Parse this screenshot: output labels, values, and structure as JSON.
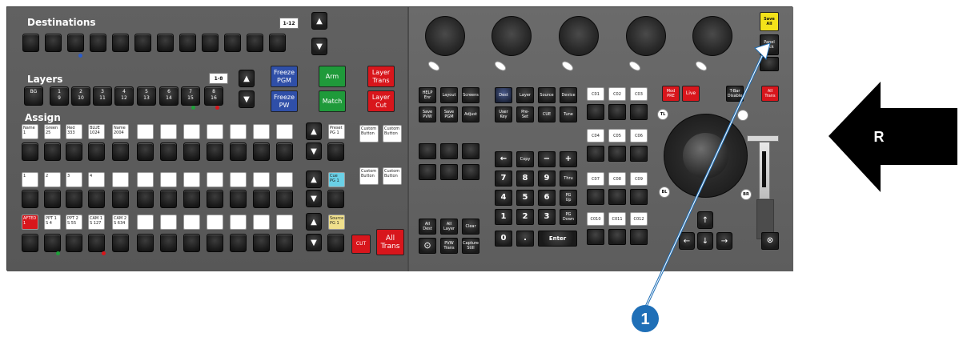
{
  "sections": {
    "destinations": "Destinations",
    "layers": "Layers",
    "assign": "Assign"
  },
  "page_tags": {
    "dest_page": "1-12",
    "layer_page": "1-8"
  },
  "layer_keys": [
    {
      "label": "BG",
      "sub": ""
    },
    {
      "label": "1",
      "sub": "9"
    },
    {
      "label": "2",
      "sub": "10"
    },
    {
      "label": "3",
      "sub": "11"
    },
    {
      "label": "4",
      "sub": "12"
    },
    {
      "label": "5",
      "sub": "13"
    },
    {
      "label": "6",
      "sub": "14"
    },
    {
      "label": "7",
      "sub": "15"
    },
    {
      "label": "8",
      "sub": "16"
    }
  ],
  "center_buttons": {
    "freeze_pgm": "Freeze\nPGM",
    "freeze_pvw": "Freeze\nPW",
    "arm": "Arm",
    "match": "Match",
    "layer_trans": "Layer\nTrans",
    "layer_cut": "Layer\nCut",
    "cut": "CUT",
    "all_trans": "All\nTrans"
  },
  "assign_rows": {
    "row1": [
      "Name\n1",
      "Green\n25",
      "Red\n333",
      "BLUE\n1024",
      "Name\n2004",
      "",
      "",
      "",
      "",
      "",
      "",
      ""
    ],
    "row2": [
      "1",
      "2",
      "3",
      "4",
      "",
      "",
      "",
      "",
      "",
      "",
      "",
      ""
    ],
    "row3": [
      "AFTED\n1",
      "PPT 1\nS  4",
      "PPT 2\nS  55",
      "CAM 1\nS  127",
      "CAM 2\nS 634",
      "",
      "",
      "",
      "",
      "",
      "",
      ""
    ]
  },
  "side_labels": {
    "preset": "Preset\nPG 1",
    "cue": "Cue\nPG 1",
    "source": "Source\nPG 1",
    "custom": "Custom\nButton"
  },
  "function_keys": [
    "HELP\nEnr",
    "Layout",
    "Screens",
    "Save\nPVW",
    "Save\nPGM",
    "Adjust",
    "Dest",
    "Layer",
    "Source",
    "Device",
    "User\nKey",
    "Pre-\nSet",
    "CUE",
    "Tune"
  ],
  "bottom_left_keys": [
    "All\nDest",
    "All\nLayer",
    "Clear",
    "",
    "PVW\nTrans",
    "Capture\nStill"
  ],
  "keypad": {
    "row1": [
      "←",
      "Copy",
      "−",
      "+"
    ],
    "row2": [
      "7",
      "8",
      "9",
      "Thru"
    ],
    "row3": [
      "4",
      "5",
      "6",
      "PG\nUp"
    ],
    "row4": [
      "1",
      "2",
      "3",
      "PG\nDown"
    ],
    "row5": [
      "0",
      ".",
      "Enter"
    ]
  },
  "cue_tags": {
    "row1": [
      "C01",
      "C02",
      "C03"
    ],
    "row2": [
      "C04",
      "C05",
      "C06"
    ],
    "row3": [
      "C07",
      "C08",
      "C09"
    ],
    "row4": [
      "C010",
      "C011",
      "C012"
    ]
  },
  "right_controls": {
    "mod_pre": "Mod\nPRE",
    "live": "Live",
    "tbar_disable": "T-Bar\nDisable",
    "all_trans": "All\nTrans",
    "save_all": "Save\nAll",
    "panel_lock": "Panel\nLock",
    "tl": "TL",
    "bl": "BL",
    "br": "BR"
  },
  "callout": {
    "number": "1",
    "letter": "R"
  },
  "colors": {
    "freeze": "#2f4fa8",
    "arm_match": "#1f9a3a",
    "red": "#d8161c",
    "cue_blue": "#6ad0e6",
    "source_yellow": "#f0e08c",
    "save_all_yellow": "#f3e21a",
    "callout_blue": "#1f6fb7"
  }
}
